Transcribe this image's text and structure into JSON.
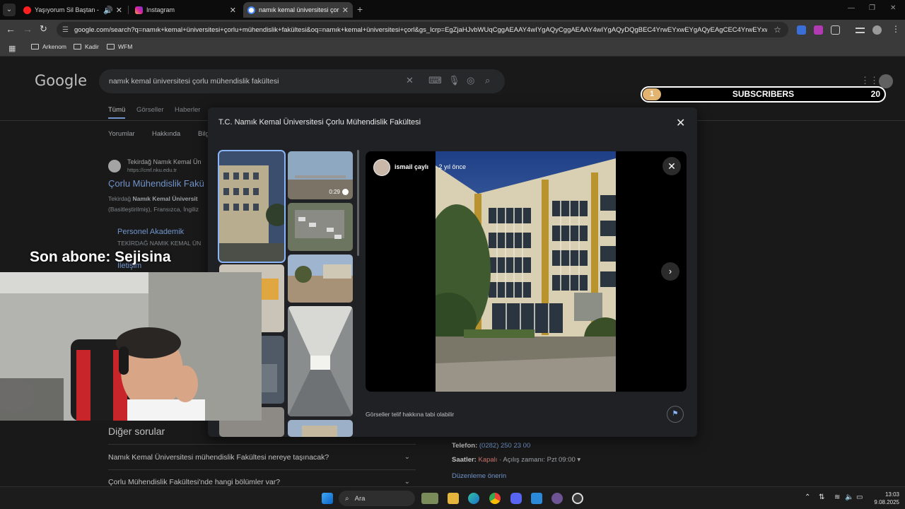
{
  "browser": {
    "tabs": [
      {
        "title": "Yaşıyorum Sil Baştan - YouT",
        "close": "✕",
        "muted_icon": "speaker-icon"
      },
      {
        "title": "Instagram",
        "close": "✕"
      },
      {
        "title": "namık kemal üniversitesi çorlu m",
        "close": "✕"
      }
    ],
    "new_tab": "+",
    "url": "google.com/search?q=namık+kemal+üniversitesi+çorlu+mühendislik+fakültesi&oq=namık+kemal+üniversitesi+çorl&gs_lcrp=EgZjaHJvbWUqCggAEAAY4wIYgAQyCggAEAAY4wIYgAQyDQgBEC4YrwEYxwEYgAQyEAgCEC4YrwEYxwEYgAQYj...",
    "bookmarks": [
      "Arkenom",
      "Kadir",
      "WFM"
    ]
  },
  "google": {
    "logo": "Google",
    "query": "namık kemal üniversitesi çorlu mühendislik fakültesi",
    "tabs": [
      "Tümü",
      "Görseller",
      "Haberler"
    ],
    "subtabs": [
      "Yorumlar",
      "Hakkında",
      "Bilg"
    ],
    "result": {
      "site": "Tekirdağ Namık Kemal Ün",
      "url": "https://cmf.nku.edu.tr",
      "title": "Çorlu Mühendislik Fakü",
      "snippet_prefix": "Tekirdağ ",
      "snippet_bold": "Namık Kemal Üniversit",
      "snippet_line2": "(Basitleştirilmiş), Fransızca, İngiliz",
      "sublink_title": "Personel Akademik",
      "sublink_desc": "TEKİRDAĞ NAMIK KEMAL ÜN",
      "sublink2": "İletişim"
    },
    "paa": {
      "title": "Diğer sorular",
      "questions": [
        "Namık Kemal Üniversitesi mühendislik Fakültesi nereye taşınacak?",
        "Çorlu Mühendislik Fakültesi'nde hangi bölümler var?"
      ]
    },
    "info": {
      "phone_label": "Telefon:",
      "phone": "(0282) 250 23 00",
      "hours_label": "Saatler:",
      "hours_status": "Kapalı",
      "hours_rest": "· Açılış zamanı: Pzt 09:00 ▾",
      "suggest_edit": "Düzenleme önerin"
    }
  },
  "viewer": {
    "title": "T.C. Namık Kemal Üniversitesi Çorlu Mühendislik Fakültesi",
    "uploader": "ismail çaylı",
    "uploaded": "· 2 yıl önce",
    "video_duration": "0:29",
    "copyright": "Görseller telif hakkına tabi olabilir"
  },
  "stream": {
    "sub_count": "1",
    "sub_label": "SUBSCRIBERS",
    "sub_goal": "20",
    "sub_progress": 0.05,
    "last_sub": "Son abone: Sejisina"
  },
  "taskbar": {
    "search": "Ara",
    "time": "13:03",
    "date": "9.08.2025"
  },
  "colors": {
    "link": "#8ab4f8",
    "goal_badge": "#e3b470",
    "background": "#1f1f1f"
  }
}
